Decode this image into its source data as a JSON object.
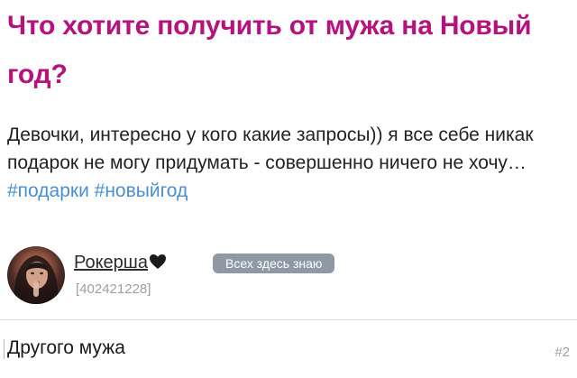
{
  "post": {
    "title": "Что хотите получить от мужа на Новый год?",
    "body_text": "Девочки, интересно у кого какие запросы)) я все себе никак подарок не могу придумать - совершенно ничего не хочу… ",
    "hashtags": [
      "#подарки",
      "#новыйгод"
    ]
  },
  "author": {
    "name": "Рокерша",
    "name_emoji_icon": "black-heart-icon",
    "badge": "Всех здесь знаю",
    "user_id": "[402421228]",
    "avatar_icon": "user-avatar-photo"
  },
  "comment": {
    "text": "Другого мужа",
    "number": "#2"
  },
  "colors": {
    "title": "#b5127e",
    "hashtag": "#4a8fd1",
    "badge_bg": "#8e99a5",
    "muted": "#9aa0a6"
  }
}
